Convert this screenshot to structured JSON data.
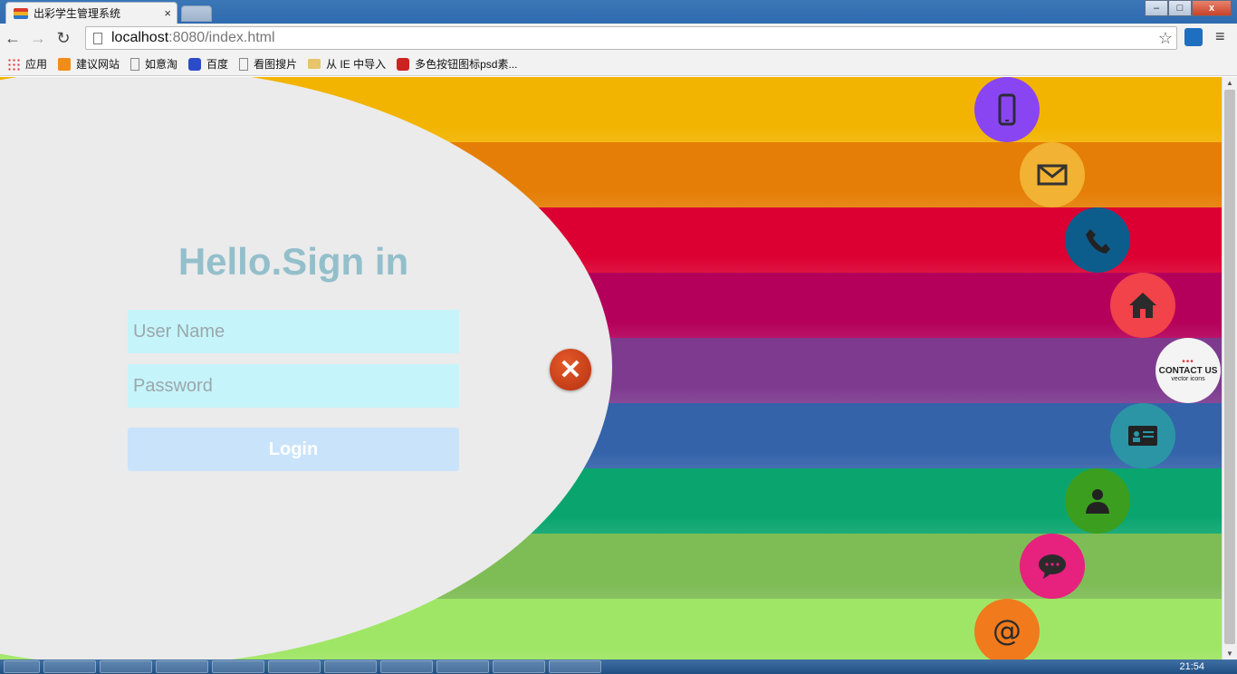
{
  "browser": {
    "tab_title": "出彩学生管理系统",
    "tab_close": "×",
    "url_host": "localhost",
    "url_path": ":8080/index.html",
    "win_minimize": "–",
    "win_maximize": "□",
    "win_close": "x"
  },
  "bookmarks": [
    {
      "label": "应用",
      "icon": "apps-icon"
    },
    {
      "label": "建议网站",
      "icon": "bulb-icon"
    },
    {
      "label": "如意淘",
      "icon": "doc-icon"
    },
    {
      "label": "百度",
      "icon": "paw-icon"
    },
    {
      "label": "看图搜片",
      "icon": "doc-icon"
    },
    {
      "label": "从 IE 中导入",
      "icon": "folder-icon"
    },
    {
      "label": "多色按钮图标psd素...",
      "icon": "red-icon"
    }
  ],
  "login": {
    "heading": "Hello.Sign in",
    "username_placeholder": "User Name",
    "password_placeholder": "Password",
    "submit_label": "Login"
  },
  "stripes": [
    "#f2b400",
    "#e57e06",
    "#dc0032",
    "#b4005a",
    "#7e3a8f",
    "#3563aa",
    "#0aa56f",
    "#7ebc55",
    "#a0e666"
  ],
  "contact_badge": {
    "title": "CONTACT US",
    "subtitle": "vector icons"
  },
  "taskbar": {
    "clock": "21:54"
  }
}
